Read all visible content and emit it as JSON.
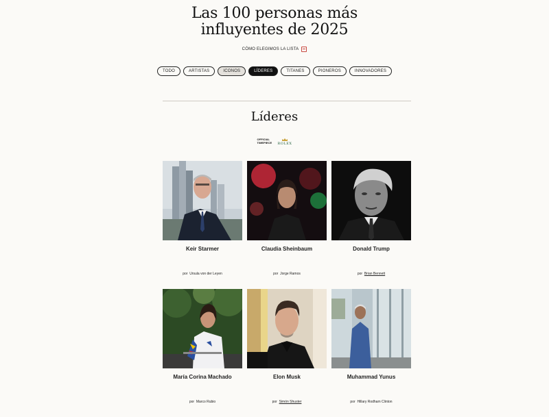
{
  "page": {
    "title": "Las 100 personas más influyentes de 2025",
    "how_we_chose": "CÓMO ELEGIMOS LA LISTA",
    "section_title": "Líderes",
    "by_prefix": "por"
  },
  "tabs": [
    {
      "label": "TODO",
      "state": "normal"
    },
    {
      "label": "ARTISTAS",
      "state": "normal"
    },
    {
      "label": "ICONOS",
      "state": "soft"
    },
    {
      "label": "LÍDERES",
      "state": "active"
    },
    {
      "label": "TITANES",
      "state": "normal"
    },
    {
      "label": "PIONEROS",
      "state": "normal"
    },
    {
      "label": "INNOVADORES",
      "state": "normal"
    }
  ],
  "sponsor": {
    "label": "OFFICIAL TIMEPIECE",
    "brand": "ROLEX",
    "brand_color": "#1e5d3a"
  },
  "people": [
    {
      "name": "Keir Starmer",
      "author": "Ursula von der Leyen"
    },
    {
      "name": "Claudia Sheinbaum",
      "author": "Jorge Ramos"
    },
    {
      "name": "Donald Trump",
      "author": "Brian Bennett"
    },
    {
      "name": "María Corina Machado",
      "author": "Marco Rubio"
    },
    {
      "name": "Elon Musk",
      "author": "Simón Shuster"
    },
    {
      "name": "Muhammad Yunus",
      "author": "Hillary Rodham Clinton"
    }
  ]
}
